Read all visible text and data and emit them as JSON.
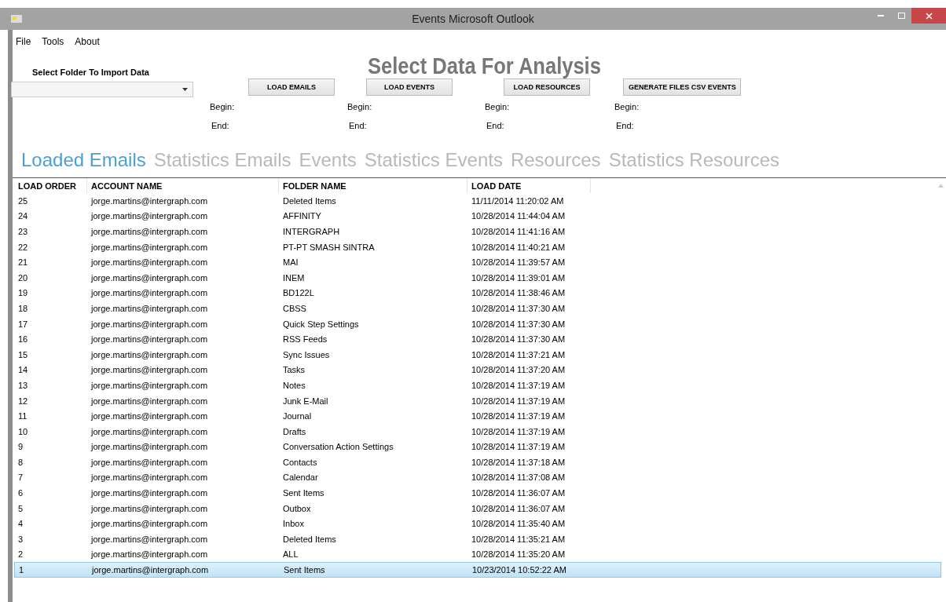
{
  "window": {
    "title": "Events Microsoft Outlook"
  },
  "menu": [
    "File",
    "Tools",
    "About"
  ],
  "heading": "Select Data For Analysis",
  "folder_label": "Select Folder To Import Data",
  "buttons": [
    {
      "label": "LOAD EMAILS",
      "begin": "Begin:",
      "end": "End:"
    },
    {
      "label": "LOAD EVENTS",
      "begin": "Begin:",
      "end": "End:"
    },
    {
      "label": "LOAD RESOURCES",
      "begin": "Begin:",
      "end": "End:"
    },
    {
      "label": "GENERATE FILES CSV EVENTS",
      "begin": "Begin:",
      "end": "End:"
    }
  ],
  "tabs": [
    {
      "label": "Loaded Emails",
      "selected": true
    },
    {
      "label": "Statistics Emails",
      "selected": false
    },
    {
      "label": "Events",
      "selected": false
    },
    {
      "label": "Statistics Events",
      "selected": false
    },
    {
      "label": "Resources",
      "selected": false
    },
    {
      "label": "Statistics Resources",
      "selected": false
    }
  ],
  "table": {
    "columns": [
      "LOAD ORDER",
      "ACCOUNT NAME",
      "FOLDER NAME",
      "LOAD DATE"
    ],
    "rows": [
      {
        "cells": [
          "25",
          "jorge.martins@intergraph.com",
          "Deleted Items",
          "11/11/2014 11:20:02 AM"
        ],
        "selected": false
      },
      {
        "cells": [
          "24",
          "jorge.martins@intergraph.com",
          "AFFINITY",
          "10/28/2014 11:44:04 AM"
        ],
        "selected": false
      },
      {
        "cells": [
          "23",
          "jorge.martins@intergraph.com",
          "INTERGRAPH",
          "10/28/2014 11:41:16 AM"
        ],
        "selected": false
      },
      {
        "cells": [
          "22",
          "jorge.martins@intergraph.com",
          "PT-PT SMASH SINTRA",
          "10/28/2014 11:40:21 AM"
        ],
        "selected": false
      },
      {
        "cells": [
          "21",
          "jorge.martins@intergraph.com",
          "MAI",
          "10/28/2014 11:39:57 AM"
        ],
        "selected": false
      },
      {
        "cells": [
          "20",
          "jorge.martins@intergraph.com",
          "INEM",
          "10/28/2014 11:39:01 AM"
        ],
        "selected": false
      },
      {
        "cells": [
          "19",
          "jorge.martins@intergraph.com",
          "BD122L",
          "10/28/2014 11:38:46 AM"
        ],
        "selected": false
      },
      {
        "cells": [
          "18",
          "jorge.martins@intergraph.com",
          "CBSS",
          "10/28/2014 11:37:30 AM"
        ],
        "selected": false
      },
      {
        "cells": [
          "17",
          "jorge.martins@intergraph.com",
          "Quick Step Settings",
          "10/28/2014 11:37:30 AM"
        ],
        "selected": false
      },
      {
        "cells": [
          "16",
          "jorge.martins@intergraph.com",
          "RSS Feeds",
          "10/28/2014 11:37:30 AM"
        ],
        "selected": false
      },
      {
        "cells": [
          "15",
          "jorge.martins@intergraph.com",
          "Sync Issues",
          "10/28/2014 11:37:21 AM"
        ],
        "selected": false
      },
      {
        "cells": [
          "14",
          "jorge.martins@intergraph.com",
          "Tasks",
          "10/28/2014 11:37:20 AM"
        ],
        "selected": false
      },
      {
        "cells": [
          "13",
          "jorge.martins@intergraph.com",
          "Notes",
          "10/28/2014 11:37:19 AM"
        ],
        "selected": false
      },
      {
        "cells": [
          "12",
          "jorge.martins@intergraph.com",
          "Junk E-Mail",
          "10/28/2014 11:37:19 AM"
        ],
        "selected": false
      },
      {
        "cells": [
          "11",
          "jorge.martins@intergraph.com",
          "Journal",
          "10/28/2014 11:37:19 AM"
        ],
        "selected": false
      },
      {
        "cells": [
          "10",
          "jorge.martins@intergraph.com",
          "Drafts",
          "10/28/2014 11:37:19 AM"
        ],
        "selected": false
      },
      {
        "cells": [
          "9",
          "jorge.martins@intergraph.com",
          "Conversation Action Settings",
          "10/28/2014 11:37:19 AM"
        ],
        "selected": false
      },
      {
        "cells": [
          "8",
          "jorge.martins@intergraph.com",
          "Contacts",
          "10/28/2014 11:37:18 AM"
        ],
        "selected": false
      },
      {
        "cells": [
          "7",
          "jorge.martins@intergraph.com",
          "Calendar",
          "10/28/2014 11:37:08 AM"
        ],
        "selected": false
      },
      {
        "cells": [
          "6",
          "jorge.martins@intergraph.com",
          "Sent Items",
          "10/28/2014 11:36:07 AM"
        ],
        "selected": false
      },
      {
        "cells": [
          "5",
          "jorge.martins@intergraph.com",
          "Outbox",
          "10/28/2014 11:36:07 AM"
        ],
        "selected": false
      },
      {
        "cells": [
          "4",
          "jorge.martins@intergraph.com",
          "Inbox",
          "10/28/2014 11:35:40 AM"
        ],
        "selected": false
      },
      {
        "cells": [
          "3",
          "jorge.martins@intergraph.com",
          "Deleted Items",
          "10/28/2014 11:35:21 AM"
        ],
        "selected": false
      },
      {
        "cells": [
          "2",
          "jorge.martins@intergraph.com",
          "ALL",
          "10/28/2014 11:35:20 AM"
        ],
        "selected": false
      },
      {
        "cells": [
          "1",
          "jorge.martins@intergraph.com",
          "Sent Items",
          "10/23/2014 10:52:22 AM"
        ],
        "selected": true
      }
    ]
  }
}
